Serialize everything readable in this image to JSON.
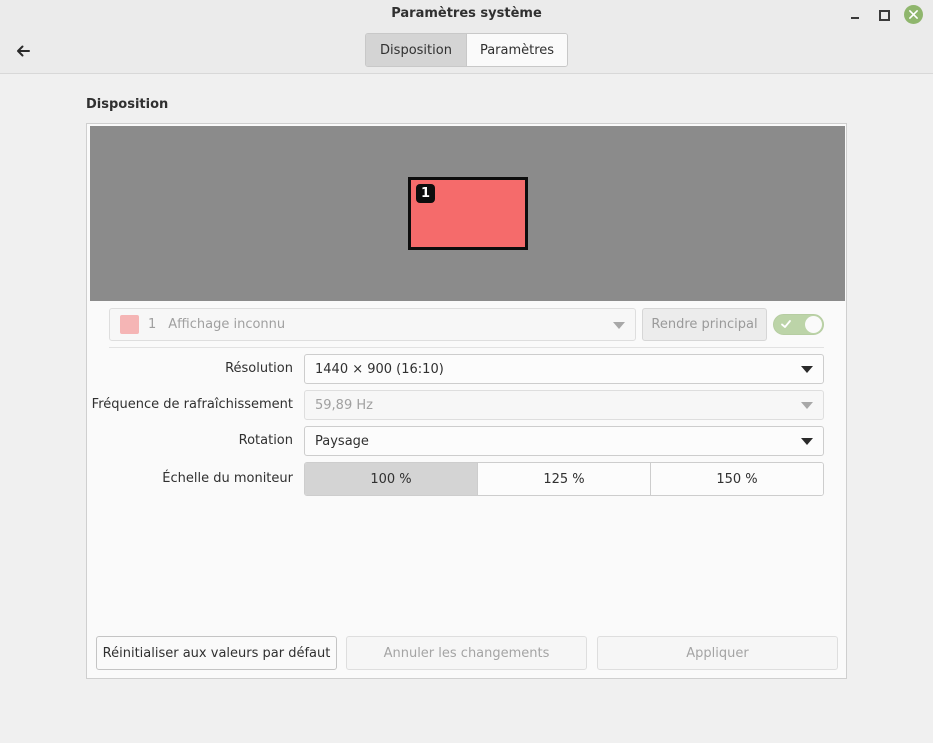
{
  "window": {
    "title": "Paramètres système",
    "controls": [
      "minimize-icon",
      "maximize-icon",
      "close-icon"
    ],
    "close_color": "#8fb66d"
  },
  "header": {
    "back_icon": "arrow-left-icon",
    "tabs": [
      {
        "label": "Disposition",
        "active": true
      },
      {
        "label": "Paramètres",
        "active": false
      }
    ]
  },
  "layout": {
    "section_title": "Disposition",
    "canvas_color": "#8b8b8b",
    "monitor": {
      "badge": "1",
      "color": "#f56b6b"
    }
  },
  "display_selector": {
    "number": "1",
    "name": "Affichage inconnu",
    "swatch_color": "#f5b5b5",
    "primary_button": "Rendre principal",
    "enabled": true
  },
  "settings": {
    "resolution": {
      "label": "Résolution",
      "value": "1440 × 900 (16:10)"
    },
    "refresh": {
      "label": "Fréquence de rafraîchissement",
      "value": "59,89 Hz"
    },
    "rotation": {
      "label": "Rotation",
      "value": "Paysage"
    },
    "scale": {
      "label": "Échelle du moniteur",
      "options": [
        "100 %",
        "125 %",
        "150 %"
      ],
      "selected": "100 %"
    }
  },
  "actions": {
    "reset": "Réinitialiser aux valeurs par défaut",
    "cancel": "Annuler les changements",
    "apply": "Appliquer"
  }
}
